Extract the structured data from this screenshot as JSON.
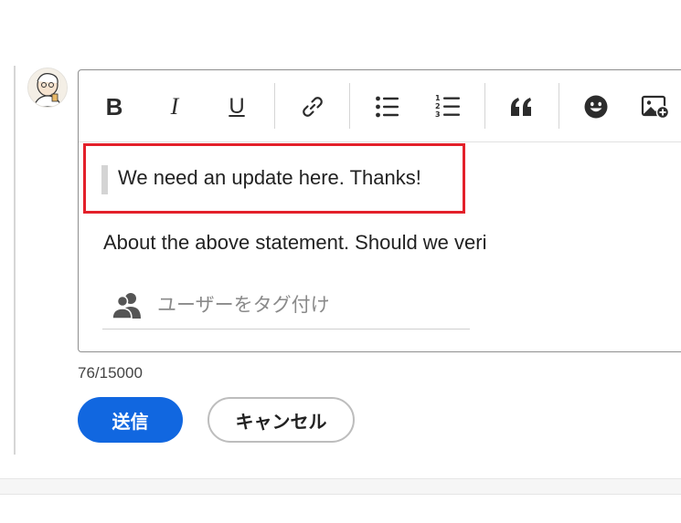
{
  "toolbar": {
    "bold_label": "B",
    "italic_label": "I",
    "underline_label": "U"
  },
  "editor": {
    "quote_text": "We need an update here. Thanks!",
    "body_text": "About the above statement. Should we veri",
    "highlight_color": "#e3202a"
  },
  "tag": {
    "placeholder": "ユーザーをタグ付け"
  },
  "counter": "76/15000",
  "actions": {
    "send_label": "送信",
    "cancel_label": "キャンセル",
    "send_color": "#1167e0"
  }
}
